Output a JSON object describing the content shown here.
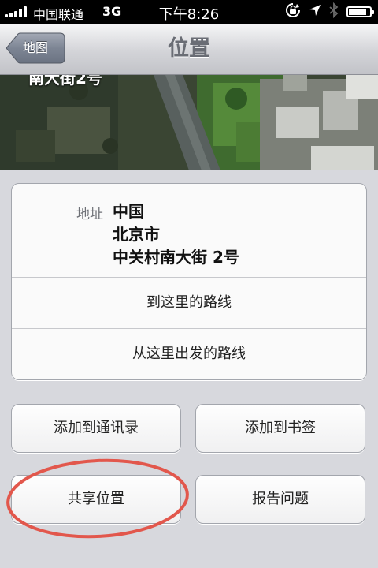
{
  "status_bar": {
    "carrier": "中国联通",
    "network": "3G",
    "time": "下午8:26",
    "icons": [
      "rotation-lock-icon",
      "location-arrow-icon",
      "bluetooth-icon",
      "battery-icon"
    ]
  },
  "nav": {
    "back_label": "地图",
    "title": "位置"
  },
  "map": {
    "overlay_text": "南大街2号"
  },
  "details": {
    "address_label": "地址",
    "address_lines": [
      "中国",
      "北京市",
      "中关村南大街 2号"
    ],
    "directions_to_label": "到这里的路线",
    "directions_from_label": "从这里出发的路线"
  },
  "buttons": {
    "add_to_contacts": "添加到通讯录",
    "add_bookmark": "添加到书签",
    "share_location": "共享位置",
    "report_problem": "报告问题"
  },
  "colors": {
    "background": "#d7d8dd",
    "annotation_circle": "#e2574c",
    "back_button": "#7a8190"
  }
}
